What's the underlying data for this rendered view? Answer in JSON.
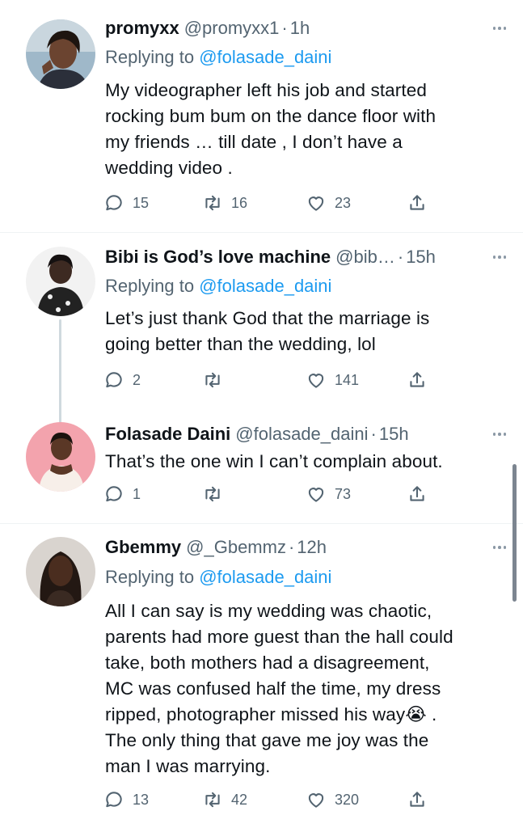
{
  "tweets": [
    {
      "name": "promyxx",
      "handle": "@promyxx1",
      "time": "1h",
      "replying_prefix": "Replying to",
      "replying_to": "@folasade_daini",
      "text": "My videographer left his job and started\nrocking bum bum on the dance floor with\nmy friends … till date , I don’t have a\nwedding video .",
      "replies": "15",
      "retweets": "16",
      "likes": "23"
    },
    {
      "name": "Bibi is God’s love machine",
      "handle": "@bib…",
      "time": "15h",
      "replying_prefix": "Replying to",
      "replying_to": "@folasade_daini",
      "text": "Let’s just thank God that the marriage is\ngoing better than the wedding, lol",
      "replies": "2",
      "retweets": "",
      "likes": "141"
    },
    {
      "name": "Folasade Daini",
      "handle": "@folasade_daini",
      "time": "15h",
      "text": "That’s the one win I can’t complain about.",
      "replies": "1",
      "retweets": "",
      "likes": "73"
    },
    {
      "name": "Gbemmy",
      "handle": "@_Gbemmz",
      "time": "12h",
      "replying_prefix": "Replying to",
      "replying_to": "@folasade_daini",
      "text": "All I can say is my wedding was chaotic,\nparents had more guest than the hall could\ntake, both mothers had a disagreement,\nMC was confused half the time, my dress\nripped, photographer missed his way😭 .\nThe only thing that gave me joy was the\nman I was marrying.",
      "replies": "13",
      "retweets": "42",
      "likes": "320"
    }
  ],
  "separator": "·",
  "icons": [
    "reply-icon",
    "retweet-icon",
    "like-icon",
    "share-icon",
    "more-icon"
  ],
  "colors": {
    "link": "#1d9bf0",
    "secondary": "#536471",
    "text": "#0f1419"
  }
}
